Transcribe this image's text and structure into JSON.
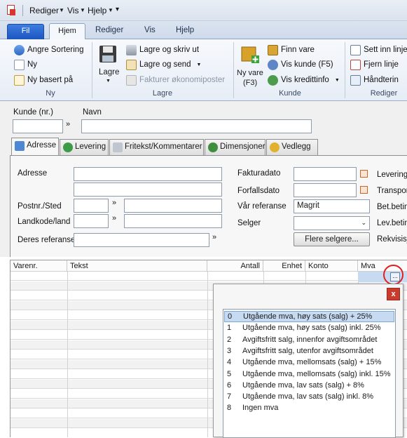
{
  "qat": {
    "menu_rediger": "Rediger",
    "menu_vis": "Vis",
    "menu_hjelp": "Hjelp",
    "customize": "▾"
  },
  "tabs": {
    "fil": "Fil",
    "hjem": "Hjem",
    "rediger": "Rediger",
    "vis": "Vis",
    "hjelp": "Hjelp"
  },
  "ribbon": {
    "ny_group": {
      "label": "Ny",
      "angre_sortering": "Angre Sortering",
      "ny": "Ny",
      "ny_basert_pa": "Ny basert på"
    },
    "lagre_group": {
      "label": "Lagre",
      "lagre": "Lagre",
      "lagre_og_skriv_ut": "Lagre og skriv ut",
      "lagre_og_send": "Lagre og send",
      "fakturer": "Fakturer økonomiposter"
    },
    "kunde_group": {
      "label": "Kunde",
      "ny_vare_line1": "Ny vare",
      "ny_vare_line2": "(F3)",
      "finn_vare": "Finn vare",
      "vis_kunde": "Vis kunde (F5)",
      "vis_kredittinfo": "Vis kredittinfo"
    },
    "rediger_group": {
      "label": "Rediger",
      "sett_inn_linje": "Sett inn linje",
      "fjern_linje": "Fjern linje",
      "handtering": "Håndterin"
    }
  },
  "customer": {
    "kunde_label": "Kunde (nr.)",
    "navn_label": "Navn",
    "kunde_value": "",
    "navn_value": ""
  },
  "doc_tabs": {
    "adresse": "Adresse",
    "levering": "Levering",
    "fritekst": "Fritekst/Kommentarer",
    "dimensjoner": "Dimensjoner",
    "vedlegg": "Vedlegg"
  },
  "address": {
    "adresse_label": "Adresse",
    "postnr_label": "Postnr./Sted",
    "landkode_label": "Landkode/land",
    "deres_referanse_label": "Deres referanse",
    "fakturadato_label": "Fakturadato",
    "forfallsdato_label": "Forfallsdato",
    "var_referanse_label": "Vår referanse",
    "var_referanse_value": "Magrit",
    "selger_label": "Selger",
    "flere_selgere": "Flere selgere...",
    "right_labels": [
      "Leverings",
      "Transport",
      "Bet.beting",
      "Lev.betin",
      "Rekvisisjo"
    ]
  },
  "grid": {
    "columns": [
      "Varenr.",
      "Tekst",
      "Antall",
      "Enhet",
      "Konto",
      "Mva"
    ],
    "lookup_button": "..."
  },
  "mva_popup": {
    "close": "x",
    "options": [
      {
        "code": "0",
        "text": "Utgående mva, høy sats (salg) + 25%",
        "selected": true
      },
      {
        "code": "1",
        "text": "Utgående mva, høy sats (salg) inkl. 25%"
      },
      {
        "code": "2",
        "text": "Avgiftsfritt salg, innenfor avgiftsområdet"
      },
      {
        "code": "3",
        "text": "Avgiftsfritt salg, utenfor avgiftsområdet"
      },
      {
        "code": "4",
        "text": "Utgående mva, mellomsats (salg) + 15%"
      },
      {
        "code": "5",
        "text": "Utgående mva, mellomsats (salg) inkl. 15%"
      },
      {
        "code": "6",
        "text": "Utgående mva, lav sats (salg) + 8%"
      },
      {
        "code": "7",
        "text": "Utgående mva, lav sats (salg) inkl. 8%"
      },
      {
        "code": "8",
        "text": "Ingen mva"
      }
    ]
  },
  "colors": {
    "fil_tab": "#2461cc",
    "highlight_circle": "#e02020",
    "selection": "#c6daf2"
  }
}
